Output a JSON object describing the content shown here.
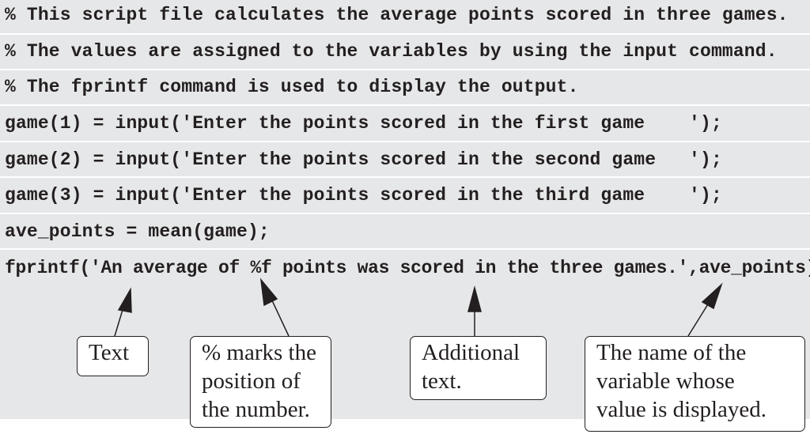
{
  "code_lines": [
    "% This script file calculates the average points scored in three games.",
    "% The values are assigned to the variables by using the input command.",
    "% The fprintf command is used to display the output.",
    "game(1) = input('Enter the points scored in the first game    ');",
    "game(2) = input('Enter the points scored in the second game   ');",
    "game(3) = input('Enter the points scored in the third game    ');",
    "ave_points = mean(game);",
    "fprintf('An average of %f points was scored in the three games.',ave_points)"
  ],
  "callouts": [
    {
      "label": "Text"
    },
    {
      "label": "% marks the\nposition of\nthe number."
    },
    {
      "label": "Additional\ntext."
    },
    {
      "label": "The name of the\nvariable whose\nvalue is displayed."
    }
  ],
  "colors": {
    "background": "#e6e7e8",
    "ink": "#231f20"
  }
}
